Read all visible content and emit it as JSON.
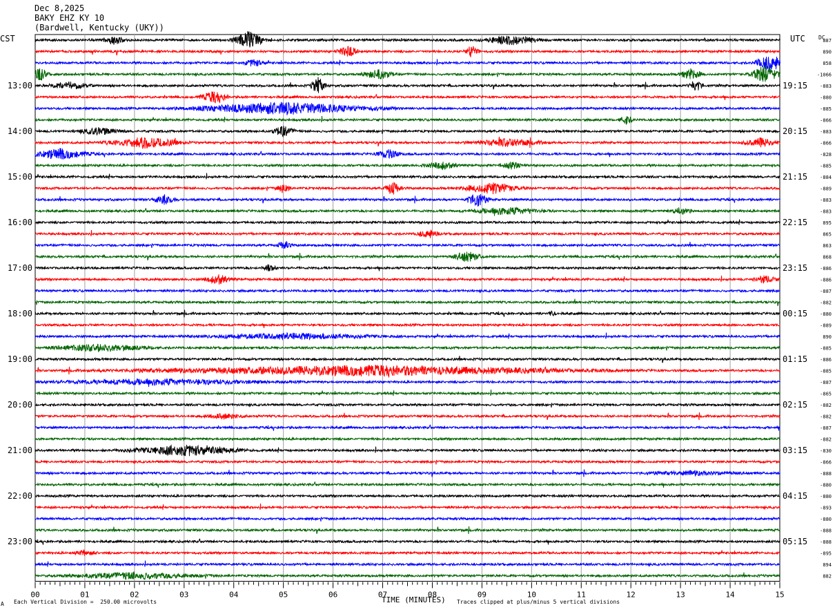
{
  "header": {
    "date": "Dec 8,2025",
    "station": "BAKY EHZ KY 10",
    "location": "(Bardwell, Kentucky (UKY))"
  },
  "left_tz": "CST",
  "right_tz": "UTC",
  "dc_label": "DC",
  "footer": {
    "scale": "Each Vertical Division =  250.00 microvolts",
    "xlabel": "TIME (MINUTES)",
    "clip_note": "Traces clipped at plus/minus 5 vertical divisions",
    "corner_mark": "A"
  },
  "colors": {
    "cycle": [
      "#000000",
      "#ff0000",
      "#0000ff",
      "#006400"
    ],
    "grid": "#a0a0a0"
  },
  "chart_data": {
    "type": "line",
    "title": "",
    "xlabel": "TIME (MINUTES)",
    "ylabel": "",
    "xlim": [
      0,
      15
    ],
    "x_ticks": [
      "00",
      "01",
      "02",
      "03",
      "04",
      "05",
      "06",
      "07",
      "08",
      "09",
      "10",
      "11",
      "12",
      "13",
      "14",
      "15"
    ],
    "grid": true,
    "trace_minutes_each": 15,
    "trace_count": 48,
    "first_trace_local_time": "12:00",
    "hour_labels_left": [
      "13:00",
      "14:00",
      "15:00",
      "16:00",
      "17:00",
      "18:00",
      "19:00",
      "20:00",
      "21:00",
      "22:00",
      "23:00"
    ],
    "hour_labels_right": [
      "19:15",
      "20:15",
      "21:15",
      "22:15",
      "23:15",
      "00:15",
      "01:15",
      "02:15",
      "03:15",
      "04:15",
      "05:15"
    ],
    "dc_offsets": [
      "887",
      "890",
      "858",
      "-1066",
      "-883",
      "-880",
      "-885",
      "-866",
      "-883",
      "-866",
      "-828",
      "-885",
      "-884",
      "-889",
      "-883",
      "-883",
      "895",
      "865",
      "863",
      "868",
      "-886",
      "-886",
      "-887",
      "-882",
      "-880",
      "-889",
      "890",
      "-885",
      "-886",
      "-885",
      "-887",
      "-865",
      "-882",
      "-882",
      "-887",
      "-882",
      "-830",
      "-866",
      "-888",
      "-880",
      "-880",
      "-893",
      "-880",
      "-888",
      "-888",
      "-895",
      "894",
      "882"
    ],
    "events": [
      {
        "trace": 0,
        "x": 4.3,
        "width": 0.4,
        "amp": 5
      },
      {
        "trace": 0,
        "x": 1.6,
        "width": 0.3,
        "amp": 2.5
      },
      {
        "trace": 0,
        "x": 9.6,
        "width": 0.8,
        "amp": 2.5
      },
      {
        "trace": 1,
        "x": 6.3,
        "width": 0.3,
        "amp": 3
      },
      {
        "trace": 1,
        "x": 8.8,
        "width": 0.2,
        "amp": 3.5
      },
      {
        "trace": 2,
        "x": 4.4,
        "width": 0.3,
        "amp": 2
      },
      {
        "trace": 2,
        "x": 14.8,
        "width": 0.4,
        "amp": 5
      },
      {
        "trace": 3,
        "x": 0.1,
        "width": 0.2,
        "amp": 4
      },
      {
        "trace": 3,
        "x": 6.9,
        "width": 0.4,
        "amp": 3
      },
      {
        "trace": 3,
        "x": 13.2,
        "width": 0.3,
        "amp": 3
      },
      {
        "trace": 3,
        "x": 14.7,
        "width": 0.4,
        "amp": 5
      },
      {
        "trace": 4,
        "x": 5.7,
        "width": 0.2,
        "amp": 5
      },
      {
        "trace": 4,
        "x": 13.3,
        "width": 0.2,
        "amp": 3.5
      },
      {
        "trace": 4,
        "x": 0.7,
        "width": 0.6,
        "amp": 1.8
      },
      {
        "trace": 5,
        "x": 3.6,
        "width": 0.4,
        "amp": 3
      },
      {
        "trace": 6,
        "x": 5.0,
        "width": 2.5,
        "amp": 3.5
      },
      {
        "trace": 7,
        "x": 11.9,
        "width": 0.2,
        "amp": 2.5
      },
      {
        "trace": 8,
        "x": 5.0,
        "width": 0.3,
        "amp": 3
      },
      {
        "trace": 8,
        "x": 1.3,
        "width": 0.6,
        "amp": 2
      },
      {
        "trace": 9,
        "x": 2.2,
        "width": 1.0,
        "amp": 3
      },
      {
        "trace": 9,
        "x": 9.5,
        "width": 1.0,
        "amp": 2
      },
      {
        "trace": 9,
        "x": 14.6,
        "width": 0.5,
        "amp": 2.5
      },
      {
        "trace": 10,
        "x": 0.5,
        "width": 0.8,
        "amp": 3
      },
      {
        "trace": 10,
        "x": 7.1,
        "width": 0.3,
        "amp": 3
      },
      {
        "trace": 11,
        "x": 8.2,
        "width": 0.5,
        "amp": 2
      },
      {
        "trace": 11,
        "x": 9.6,
        "width": 0.3,
        "amp": 2
      },
      {
        "trace": 13,
        "x": 5.0,
        "width": 0.2,
        "amp": 2.5
      },
      {
        "trace": 13,
        "x": 7.2,
        "width": 0.2,
        "amp": 4
      },
      {
        "trace": 13,
        "x": 9.2,
        "width": 0.8,
        "amp": 3
      },
      {
        "trace": 14,
        "x": 2.6,
        "width": 0.3,
        "amp": 2.5
      },
      {
        "trace": 14,
        "x": 8.9,
        "width": 0.3,
        "amp": 4
      },
      {
        "trace": 15,
        "x": 9.5,
        "width": 1.0,
        "amp": 2
      },
      {
        "trace": 15,
        "x": 13.0,
        "width": 0.3,
        "amp": 2
      },
      {
        "trace": 17,
        "x": 7.9,
        "width": 0.3,
        "amp": 2.5
      },
      {
        "trace": 18,
        "x": 5.0,
        "width": 0.2,
        "amp": 2
      },
      {
        "trace": 19,
        "x": 8.7,
        "width": 0.4,
        "amp": 3
      },
      {
        "trace": 20,
        "x": 4.7,
        "width": 0.2,
        "amp": 2
      },
      {
        "trace": 21,
        "x": 3.7,
        "width": 0.4,
        "amp": 2.5
      },
      {
        "trace": 21,
        "x": 14.7,
        "width": 0.3,
        "amp": 2
      },
      {
        "trace": 24,
        "x": 10.4,
        "width": 0.1,
        "amp": 2
      },
      {
        "trace": 26,
        "x": 5.2,
        "width": 2.5,
        "amp": 1.5
      },
      {
        "trace": 27,
        "x": 1.3,
        "width": 1.4,
        "amp": 1.8
      },
      {
        "trace": 29,
        "x": 6.6,
        "width": 6.0,
        "amp": 2.8
      },
      {
        "trace": 30,
        "x": 2.5,
        "width": 3.0,
        "amp": 1.5
      },
      {
        "trace": 33,
        "x": 3.8,
        "width": 0.5,
        "amp": 1.5
      },
      {
        "trace": 36,
        "x": 3.0,
        "width": 1.5,
        "amp": 3
      },
      {
        "trace": 38,
        "x": 13.3,
        "width": 1.4,
        "amp": 1
      },
      {
        "trace": 45,
        "x": 1.0,
        "width": 0.3,
        "amp": 1.5
      },
      {
        "trace": 47,
        "x": 2.0,
        "width": 1.8,
        "amp": 1.8
      }
    ]
  }
}
